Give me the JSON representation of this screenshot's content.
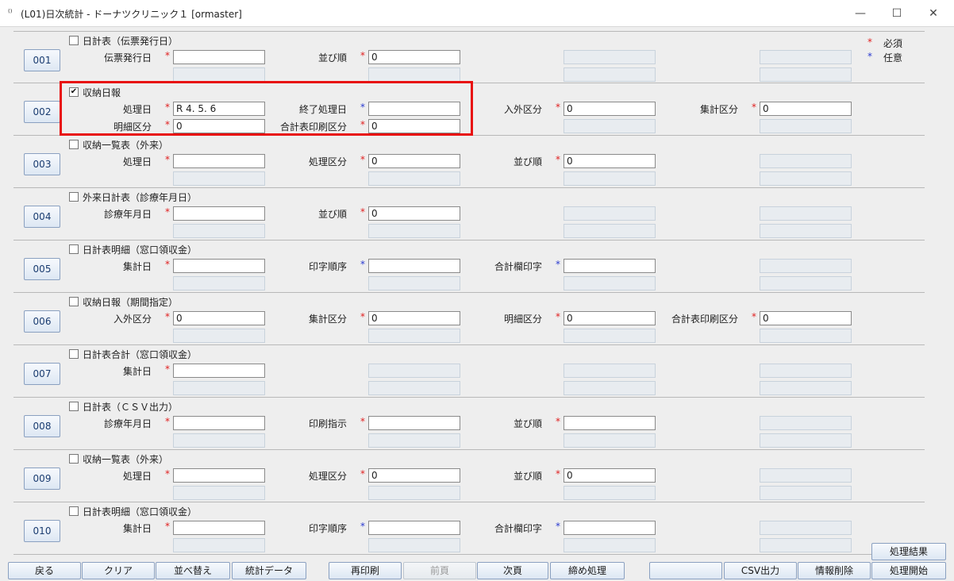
{
  "window": {
    "title": "(L01)日次統計 - ドーナツクリニック１ [ormaster]",
    "minimize": "—",
    "maximize": "☐",
    "close": "✕"
  },
  "legend": [
    {
      "mark": "*",
      "text": "必須"
    },
    {
      "mark": "*",
      "text": "任意"
    }
  ],
  "sections": [
    {
      "num": "001",
      "checked": false,
      "title": "日計表（伝票発行日）",
      "fields": [
        {
          "label": "伝票発行日",
          "mark": "*",
          "req": true,
          "value": ""
        },
        {
          "label": "並び順",
          "mark": "*",
          "req": true,
          "value": "0"
        }
      ]
    },
    {
      "num": "002",
      "checked": true,
      "title": "収納日報",
      "fields": [
        {
          "label": "処理日",
          "mark": "*",
          "req": true,
          "value": "R 4. 5. 6"
        },
        {
          "label": "終了処理日",
          "mark": "*",
          "req": false,
          "value": ""
        },
        {
          "label": "入外区分",
          "mark": "*",
          "req": true,
          "value": "0"
        },
        {
          "label": "集計区分",
          "mark": "*",
          "req": true,
          "value": "0"
        }
      ],
      "fields_row2": [
        {
          "label": "明細区分",
          "mark": "*",
          "req": true,
          "value": "0"
        },
        {
          "label": "合計表印刷区分",
          "mark": "*",
          "req": true,
          "value": "0"
        }
      ]
    },
    {
      "num": "003",
      "checked": false,
      "title": "収納一覧表（外来）",
      "fields": [
        {
          "label": "処理日",
          "mark": "*",
          "req": true,
          "value": ""
        },
        {
          "label": "処理区分",
          "mark": "*",
          "req": true,
          "value": "0"
        },
        {
          "label": "並び順",
          "mark": "*",
          "req": true,
          "value": "0"
        }
      ]
    },
    {
      "num": "004",
      "checked": false,
      "title": "外来日計表（診療年月日）",
      "fields": [
        {
          "label": "診療年月日",
          "mark": "*",
          "req": true,
          "value": ""
        },
        {
          "label": "並び順",
          "mark": "*",
          "req": true,
          "value": "0"
        }
      ]
    },
    {
      "num": "005",
      "checked": false,
      "title": "日計表明細（窓口領収金）",
      "fields": [
        {
          "label": "集計日",
          "mark": "*",
          "req": true,
          "value": ""
        },
        {
          "label": "印字順序",
          "mark": "*",
          "req": false,
          "value": ""
        },
        {
          "label": "合計欄印字",
          "mark": "*",
          "req": false,
          "value": ""
        }
      ]
    },
    {
      "num": "006",
      "checked": false,
      "title": "収納日報（期間指定）",
      "fields": [
        {
          "label": "入外区分",
          "mark": "*",
          "req": true,
          "value": "0"
        },
        {
          "label": "集計区分",
          "mark": "*",
          "req": true,
          "value": "0"
        },
        {
          "label": "明細区分",
          "mark": "*",
          "req": true,
          "value": "0"
        },
        {
          "label": "合計表印刷区分",
          "mark": "*",
          "req": true,
          "value": "0"
        }
      ]
    },
    {
      "num": "007",
      "checked": false,
      "title": "日計表合計（窓口領収金）",
      "fields": [
        {
          "label": "集計日",
          "mark": "*",
          "req": true,
          "value": ""
        }
      ]
    },
    {
      "num": "008",
      "checked": false,
      "title": "日計表（ＣＳＶ出力）",
      "fields": [
        {
          "label": "診療年月日",
          "mark": "*",
          "req": true,
          "value": ""
        },
        {
          "label": "印刷指示",
          "mark": "*",
          "req": true,
          "value": ""
        },
        {
          "label": "並び順",
          "mark": "*",
          "req": true,
          "value": ""
        }
      ]
    },
    {
      "num": "009",
      "checked": false,
      "title": "収納一覧表（外来）",
      "fields": [
        {
          "label": "処理日",
          "mark": "*",
          "req": true,
          "value": ""
        },
        {
          "label": "処理区分",
          "mark": "*",
          "req": true,
          "value": "0"
        },
        {
          "label": "並び順",
          "mark": "*",
          "req": true,
          "value": "0"
        }
      ]
    },
    {
      "num": "010",
      "checked": false,
      "title": "日計表明細（窓口領収金）",
      "fields": [
        {
          "label": "集計日",
          "mark": "*",
          "req": true,
          "value": ""
        },
        {
          "label": "印字順序",
          "mark": "*",
          "req": false,
          "value": ""
        },
        {
          "label": "合計欄印字",
          "mark": "*",
          "req": false,
          "value": ""
        }
      ]
    }
  ],
  "result_button": "処理結果",
  "buttons": [
    {
      "label": "戻る",
      "enabled": true
    },
    {
      "label": "クリア",
      "enabled": true
    },
    {
      "label": "並べ替え",
      "enabled": true
    },
    {
      "label": "統計データ",
      "enabled": true
    },
    {
      "label": "再印刷",
      "enabled": true
    },
    {
      "label": "前頁",
      "enabled": false
    },
    {
      "label": "次頁",
      "enabled": true
    },
    {
      "label": "締め処理",
      "enabled": true
    },
    {
      "label": "",
      "enabled": true
    },
    {
      "label": "CSV出力",
      "enabled": true
    },
    {
      "label": "情報削除",
      "enabled": true
    },
    {
      "label": "処理開始",
      "enabled": true
    }
  ],
  "colors": {
    "required": "#e02020",
    "optional": "#2a3ad0",
    "highlight": "#e81010"
  }
}
